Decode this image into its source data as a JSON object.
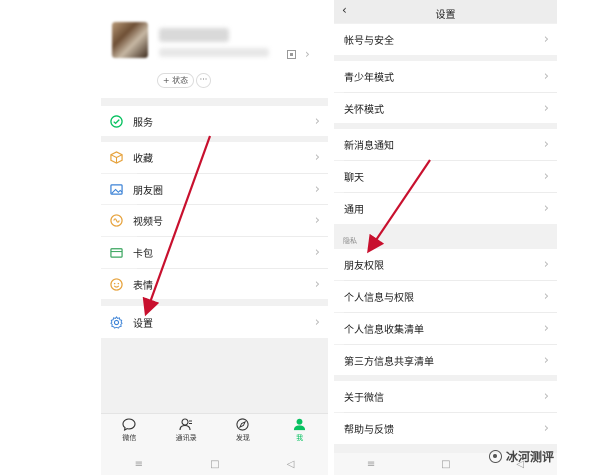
{
  "left_screen": {
    "profile": {
      "status_label": "+ 状态",
      "more_label": "···"
    },
    "menu": {
      "services": "服务",
      "favorites": "收藏",
      "moments": "朋友圈",
      "channels": "视频号",
      "cards": "卡包",
      "stickers": "表情",
      "settings": "设置"
    },
    "tabs": [
      {
        "label": "微信",
        "icon": "chat-bubble-icon"
      },
      {
        "label": "通讯录",
        "icon": "contacts-icon"
      },
      {
        "label": "发现",
        "icon": "compass-icon"
      },
      {
        "label": "我",
        "icon": "person-icon"
      }
    ],
    "active_tab": "我"
  },
  "right_screen": {
    "header": {
      "title": "设置",
      "back_icon": "chevron-left-icon"
    },
    "items": {
      "account_security": "帐号与安全",
      "teen_mode": "青少年模式",
      "care_mode": "关怀模式",
      "new_message_notification": "新消息通知",
      "chat": "聊天",
      "general": "通用",
      "privacy_section": "隐私",
      "friend_permissions": "朋友权限",
      "personal_info_permissions": "个人信息与权限",
      "personal_info_collection": "个人信息收集清单",
      "third_party_sharing": "第三方信息共享清单",
      "about_wechat": "关于微信",
      "help_feedback": "帮助与反馈"
    }
  },
  "watermark": {
    "text": "冰河测评"
  },
  "colors": {
    "accent_green": "#07c160",
    "annotation_arrow": "#c8102e"
  }
}
